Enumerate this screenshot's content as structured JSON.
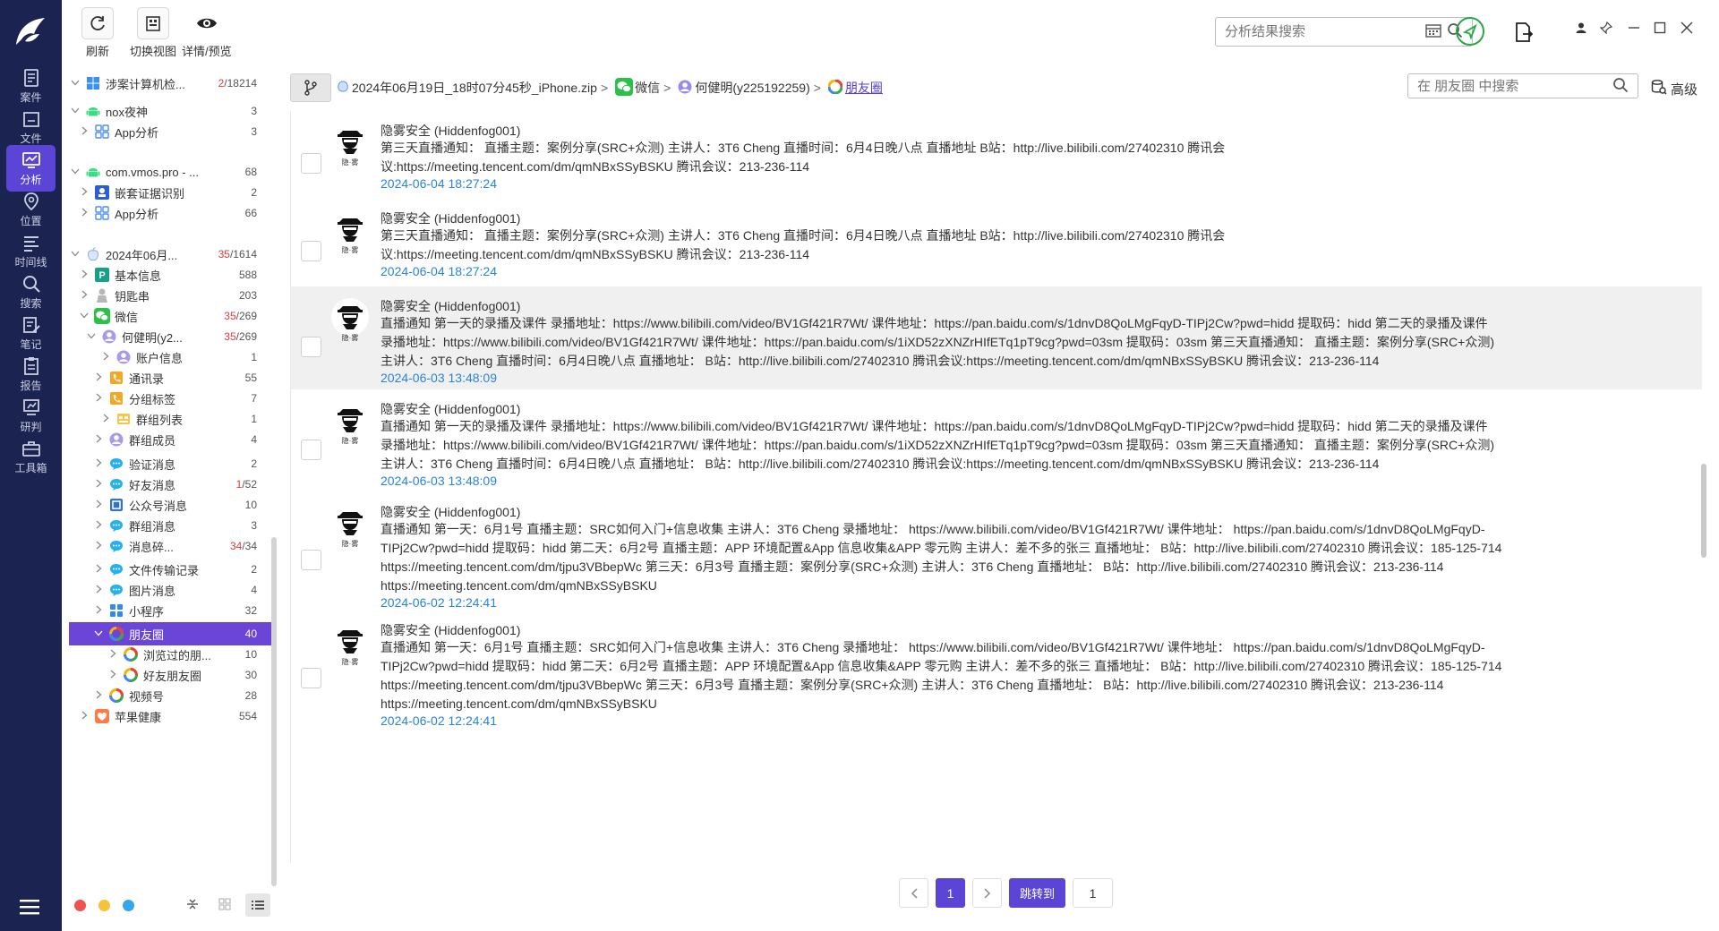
{
  "sidebar": {
    "items": [
      {
        "label": "案件",
        "icon": "case-icon"
      },
      {
        "label": "文件",
        "icon": "file-icon"
      },
      {
        "label": "分析",
        "icon": "analysis-icon"
      },
      {
        "label": "位置",
        "icon": "location-icon"
      },
      {
        "label": "时间线",
        "icon": "timeline-icon"
      },
      {
        "label": "搜索",
        "icon": "search-icon"
      },
      {
        "label": "笔记",
        "icon": "note-icon"
      },
      {
        "label": "报告",
        "icon": "report-icon"
      },
      {
        "label": "研判",
        "icon": "judge-icon"
      },
      {
        "label": "工具箱",
        "icon": "toolbox-icon"
      }
    ],
    "active_index": 2,
    "colors": {
      "bg": "#1b2450",
      "active": "#5b45d6"
    }
  },
  "toolbar": {
    "refresh_label": "刷新",
    "switch_view_label": "切换视图",
    "detail_preview_label": "详情/预览"
  },
  "top_search": {
    "placeholder": "分析结果搜索"
  },
  "tree": {
    "rows": [
      {
        "label": "涉案计算机检...",
        "count": "2",
        "count_total": "/18214",
        "icon": "windows-icon",
        "expanded": true
      },
      {
        "label": "nox夜神",
        "count": "3",
        "icon": "android-icon",
        "expanded": true
      },
      {
        "label": "App分析",
        "count": "3",
        "icon": "app-grid-icon"
      },
      {
        "label": "com.vmos.pro - ...",
        "count": "68",
        "icon": "android-icon",
        "expanded": true
      },
      {
        "label": "嵌套证据识别",
        "count": "2",
        "icon": "nested-evidence-icon"
      },
      {
        "label": "App分析",
        "count": "66",
        "icon": "app-grid-icon"
      },
      {
        "label": "2024年06月...",
        "count": "35",
        "count_total": "/1614",
        "icon": "apple-icon",
        "expanded": true
      },
      {
        "label": "基本信息",
        "count": "588",
        "icon": "basic-info-icon"
      },
      {
        "label": "钥匙串",
        "count": "203",
        "icon": "keychain-icon"
      },
      {
        "label": "微信",
        "count": "35",
        "count_total": "/269",
        "icon": "wechat-icon",
        "expanded": true
      },
      {
        "label": "何健明(y2...",
        "count": "35",
        "count_total": "/269",
        "icon": "user-icon",
        "expanded": true
      },
      {
        "label": "账户信息",
        "count": "1",
        "icon": "account-icon"
      },
      {
        "label": "通讯录",
        "count": "55",
        "icon": "contacts-icon"
      },
      {
        "label": "分组标签",
        "count": "7",
        "icon": "tag-icon"
      },
      {
        "label": "群组列表",
        "count": "1",
        "icon": "group-list-icon"
      },
      {
        "label": "群组成员",
        "count": "4",
        "icon": "group-member-icon"
      },
      {
        "label": "验证消息",
        "count": "2",
        "icon": "chat-bubble-icon"
      },
      {
        "label": "好友消息",
        "count": "1",
        "count_total": "/52",
        "icon": "chat-bubble-icon"
      },
      {
        "label": "公众号消息",
        "count": "10",
        "icon": "official-account-icon"
      },
      {
        "label": "群组消息",
        "count": "3",
        "icon": "chat-bubble-icon"
      },
      {
        "label": "消息碎...",
        "count": "34",
        "count_total": "/34",
        "icon": "chat-bubble-icon"
      },
      {
        "label": "文件传输记录",
        "count": "2",
        "icon": "chat-bubble-icon"
      },
      {
        "label": "图片消息",
        "count": "4",
        "icon": "chat-bubble-icon"
      },
      {
        "label": "小程序",
        "count": "32",
        "icon": "mini-program-icon"
      },
      {
        "label": "朋友圈",
        "count": "40",
        "icon": "moments-icon",
        "expanded": true,
        "selected": true
      },
      {
        "label": "浏览过的朋...",
        "count": "10",
        "icon": "moments-icon"
      },
      {
        "label": "好友朋友圈",
        "count": "30",
        "icon": "moments-icon"
      },
      {
        "label": "视频号",
        "count": "28",
        "icon": "channels-icon"
      },
      {
        "label": "苹果健康",
        "count": "554",
        "icon": "health-icon"
      }
    ]
  },
  "breadcrumb": {
    "items": [
      {
        "label": "2024年06月19日_18时07分45秒_iPhone.zip",
        "icon": "zip-icon"
      },
      {
        "label": "微信",
        "icon": "wechat-icon"
      },
      {
        "label": "何健明(y225192259)",
        "icon": "user-icon"
      },
      {
        "label": "朋友圈",
        "icon": "moments-icon"
      }
    ]
  },
  "inner_search": {
    "placeholder": "在 朋友圈 中搜索"
  },
  "advanced_label": "高级",
  "messages": [
    {
      "sender": "隐雾安全 (Hiddenfog001)",
      "lines": [
        "第三天直播通知：  直播主题：案例分享(SRC+众测) 主讲人：3T6 Cheng 直播时间：6月4日晚八点 直播地址 B站：http://live.bilibili.com/27402310 腾讯会",
        "议:https://meeting.tencent.com/dm/qmNBxSSyBSKU 腾讯会议：213-236-114"
      ],
      "time": "2024-06-04 18:27:24"
    },
    {
      "sender": "隐雾安全 (Hiddenfog001)",
      "lines": [
        "第三天直播通知：  直播主题：案例分享(SRC+众测) 主讲人：3T6 Cheng 直播时间：6月4日晚八点 直播地址 B站：http://live.bilibili.com/27402310 腾讯会",
        "议:https://meeting.tencent.com/dm/qmNBxSSyBSKU 腾讯会议：213-236-114"
      ],
      "time": "2024-06-04 18:27:24"
    },
    {
      "sender": "隐雾安全 (Hiddenfog001)",
      "lines": [
        "直播通知 第一天的录播及课件 录播地址：https://www.bilibili.com/video/BV1Gf421R7Wt/ 课件地址：https://pan.baidu.com/s/1dnvD8QoLMgFqyD-TIPj2Cw?pwd=hidd 提取码：hidd 第二天的录播及课件",
        "录播地址：https://www.bilibili.com/video/BV1Gf421R7Wt/ 课件地址：https://pan.baidu.com/s/1iXD52zXNZrHIfETq1pT9cg?pwd=03sm 提取码：03sm 第三天直播通知：  直播主题：案例分享(SRC+众测)",
        "主讲人：3T6 Cheng 直播时间：6月4日晚八点 直播地址：  B站：http://live.bilibili.com/27402310 腾讯会议:https://meeting.tencent.com/dm/qmNBxSSyBSKU 腾讯会议：213-236-114"
      ],
      "time": "2024-06-03 13:48:09",
      "highlighted": true
    },
    {
      "sender": "隐雾安全 (Hiddenfog001)",
      "lines": [
        "直播通知 第一天的录播及课件 录播地址：https://www.bilibili.com/video/BV1Gf421R7Wt/ 课件地址：https://pan.baidu.com/s/1dnvD8QoLMgFqyD-TIPj2Cw?pwd=hidd 提取码：hidd 第二天的录播及课件",
        "录播地址：https://www.bilibili.com/video/BV1Gf421R7Wt/ 课件地址：https://pan.baidu.com/s/1iXD52zXNZrHIfETq1pT9cg?pwd=03sm 提取码：03sm 第三天直播通知：  直播主题：案例分享(SRC+众测)",
        "主讲人：3T6 Cheng 直播时间：6月4日晚八点 直播地址：  B站：http://live.bilibili.com/27402310 腾讯会议:https://meeting.tencent.com/dm/qmNBxSSyBSKU 腾讯会议：213-236-114"
      ],
      "time": "2024-06-03 13:48:09"
    },
    {
      "sender": "隐雾安全 (Hiddenfog001)",
      "lines": [
        "直播通知 第一天：6月1号 直播主题：SRC如何入门+信息收集 主讲人：3T6 Cheng 录播地址：  https://www.bilibili.com/video/BV1Gf421R7Wt/ 课件地址：  https://pan.baidu.com/s/1dnvD8QoLMgFqyD-",
        "TIPj2Cw?pwd=hidd 提取码：hidd 第二天：6月2号 直播主题：APP 环境配置&App 信息收集&APP 零元购 主讲人：差不多的张三 直播地址：  B站：http://live.bilibili.com/27402310 腾讯会议：185-125-714",
        "https://meeting.tencent.com/dm/tjpu3VBbepWc 第三天：6月3号 直播主题：案例分享(SRC+众测) 主讲人：3T6 Cheng 直播地址：  B站：http://live.bilibili.com/27402310 腾讯会议：213-236-114",
        "https://meeting.tencent.com/dm/qmNBxSSyBSKU"
      ],
      "time": "2024-06-02 12:24:41"
    },
    {
      "sender": "隐雾安全 (Hiddenfog001)",
      "lines": [
        "直播通知 第一天：6月1号 直播主题：SRC如何入门+信息收集 主讲人：3T6 Cheng 录播地址：  https://www.bilibili.com/video/BV1Gf421R7Wt/ 课件地址：  https://pan.baidu.com/s/1dnvD8QoLMgFqyD-",
        "TIPj2Cw?pwd=hidd 提取码：hidd 第二天：6月2号 直播主题：APP 环境配置&App 信息收集&APP 零元购 主讲人：差不多的张三 直播地址：  B站：http://live.bilibili.com/27402310 腾讯会议：185-125-714",
        "https://meeting.tencent.com/dm/tjpu3VBbepWc 第三天：6月3号 直播主题：案例分享(SRC+众测) 主讲人：3T6 Cheng 直播地址：  B站：http://live.bilibili.com/27402310 腾讯会议：213-236-114",
        "https://meeting.tencent.com/dm/qmNBxSSyBSKU"
      ],
      "time": "2024-06-02 12:24:41"
    }
  ],
  "avatar_caption": "隐·雾",
  "pager": {
    "current": "1",
    "jump_label": "跳转到",
    "jump_value": "1"
  },
  "colors": {
    "accent": "#5b45d6",
    "time": "#2a84d8",
    "count_red": "#e03b3b"
  }
}
